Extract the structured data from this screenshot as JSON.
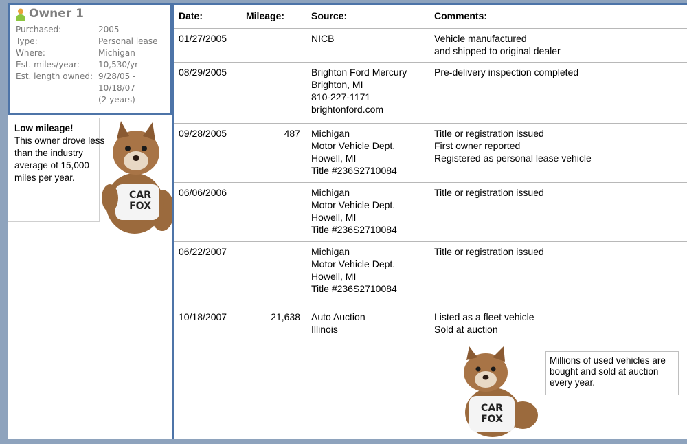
{
  "owner": {
    "title": "Owner 1",
    "info": [
      {
        "label": "Purchased:",
        "value": [
          "2005"
        ]
      },
      {
        "label": "Type:",
        "value": [
          "Personal lease"
        ]
      },
      {
        "label": "Where:",
        "value": [
          "Michigan"
        ]
      },
      {
        "label": "Est. miles/year:",
        "value": [
          "10,530/yr"
        ]
      },
      {
        "label": "Est. length owned:",
        "value": [
          "9/28/05 -",
          "10/18/07",
          "(2 years)"
        ]
      }
    ]
  },
  "callout": {
    "title": "Low mileage!",
    "body": "This owner drove less than the industry average of 15,000 miles per year."
  },
  "mascot_shirt": [
    "CAR",
    "FOX"
  ],
  "table": {
    "headers": {
      "date": "Date:",
      "mileage": "Mileage:",
      "source": "Source:",
      "comments": "Comments:"
    },
    "rows": [
      {
        "date": "01/27/2005",
        "mileage": "",
        "source": [
          "NICB"
        ],
        "comments": [
          "Vehicle manufactured",
          "and shipped to original dealer"
        ]
      },
      {
        "date": "08/29/2005",
        "mileage": "",
        "source": [
          "Brighton Ford Mercury",
          "Brighton, MI",
          "810-227-1171",
          "brightonford.com"
        ],
        "comments": [
          "Pre-delivery inspection completed"
        ]
      },
      {
        "date": "09/28/2005",
        "mileage": "487",
        "source": [
          "Michigan",
          "Motor Vehicle Dept.",
          "Howell, MI",
          "Title #236S2710084"
        ],
        "comments": [
          "Title or registration issued",
          "First owner reported",
          "Registered as personal lease vehicle"
        ]
      },
      {
        "date": "06/06/2006",
        "mileage": "",
        "source": [
          "Michigan",
          "Motor Vehicle Dept.",
          "Howell, MI",
          "Title #236S2710084"
        ],
        "comments": [
          "Title or registration issued"
        ]
      },
      {
        "date": "06/22/2007",
        "mileage": "",
        "source": [
          "Michigan",
          "Motor Vehicle Dept.",
          "Howell, MI",
          "Title #236S2710084"
        ],
        "comments": [
          "Title or registration issued"
        ]
      },
      {
        "date": "10/18/2007",
        "mileage": "21,638",
        "source": [
          "Auto Auction",
          "Illinois"
        ],
        "comments": [
          "Listed as a fleet vehicle",
          "Sold at auction"
        ]
      }
    ]
  },
  "auction_tip": "Millions of used vehicles are bought and sold at auction every year.",
  "colors": {
    "accent_border": "#4d74a8",
    "page_background": "#8ea3bd",
    "person_icon": "#e8a23a"
  }
}
